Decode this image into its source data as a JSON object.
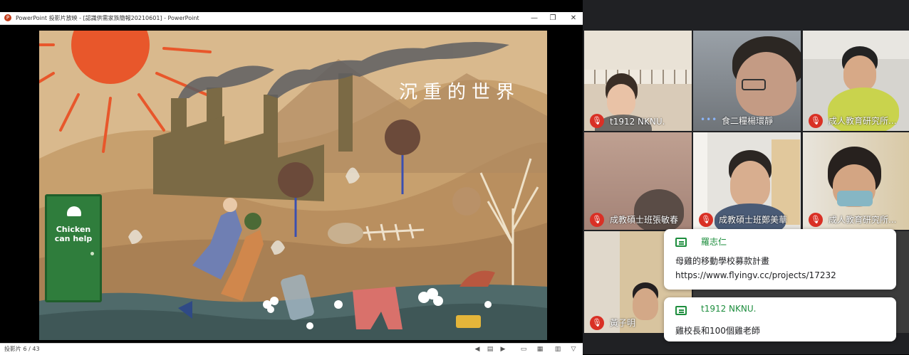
{
  "ppt": {
    "window_title": "PowerPoint 投影片放映 - [認識供需家族簡報20210601] - PowerPoint",
    "minimize_label": "—",
    "restore_label": "❐",
    "close_label": "✕",
    "slide_counter": "投影片 6 / 43",
    "slide": {
      "title": "沉重的世界",
      "door_text_line1": "Chicken",
      "door_text_line2": "can help"
    }
  },
  "meet": {
    "tiles": [
      {
        "name": "t1912 NKNU.",
        "muted": true
      },
      {
        "name": "食二糧楊環靜",
        "muted": false,
        "speaking": true
      },
      {
        "name": "成人教育研究所...",
        "muted": true
      },
      {
        "name": "成教碩士班張敏春",
        "muted": true
      },
      {
        "name": "成教碩士班鄭美華",
        "muted": true
      },
      {
        "name": "成人教育研究所...",
        "muted": true
      },
      {
        "name": "黃子明",
        "muted": true
      }
    ],
    "chats": [
      {
        "sender": "羅志仁",
        "message": "母雞的移動學校募款計畫",
        "link": "https://www.flyingv.cc/projects/17232"
      },
      {
        "sender": "t1912 NKNU.",
        "message": "雞校長和100個雞老師"
      }
    ]
  },
  "colors": {
    "meet_bg": "#202124",
    "mic_off_red": "#d93025",
    "chat_green": "#1e8e3e",
    "slide_sand": "#c9a57a"
  }
}
